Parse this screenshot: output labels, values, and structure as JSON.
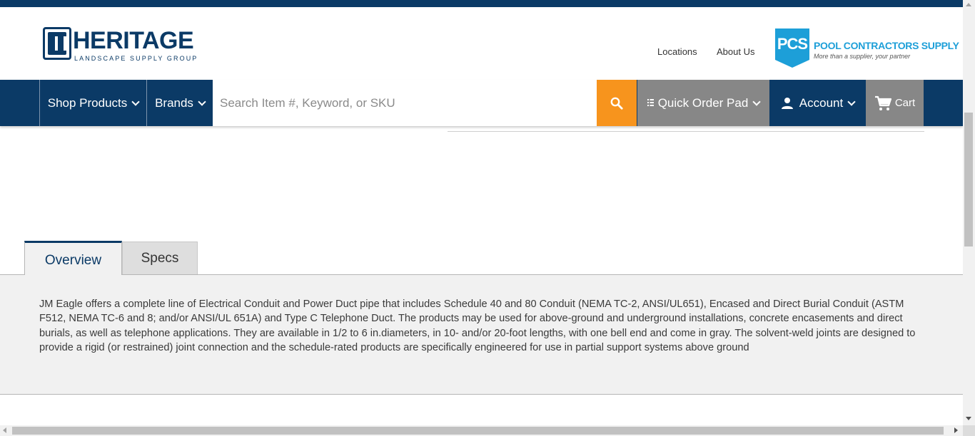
{
  "brand": {
    "name": "HERITAGE",
    "subtitle": "LANDSCAPE SUPPLY GROUP",
    "colors": {
      "navy": "#0b3a66",
      "orange": "#f7941d",
      "grey": "#878787",
      "pcs_blue": "#1d9fd8"
    }
  },
  "header": {
    "links": [
      {
        "label": "Locations"
      },
      {
        "label": "About Us"
      }
    ],
    "partner": {
      "badge": "PCS",
      "title": "POOL CONTRACTORS SUPPLY",
      "tagline": "More than a supplier, your partner"
    }
  },
  "nav": {
    "shop_products": "Shop Products",
    "brands": "Brands",
    "search_placeholder": "Search Item #, Keyword, or SKU",
    "search_icon": "search-icon",
    "quick_order": "Quick Order Pad",
    "account": "Account",
    "cart": "Cart"
  },
  "tabs": [
    {
      "label": "Overview",
      "active": true
    },
    {
      "label": "Specs",
      "active": false
    }
  ],
  "overview": {
    "text": "JM Eagle offers a complete line of Electrical Conduit and Power Duct pipe that includes Schedule 40 and 80 Conduit (NEMA TC-2, ANSI/UL651), Encased and Direct Burial Conduit (ASTM F512, NEMA TC-6 and 8; and/or ANSI/UL 651A) and Type C Telephone Duct. The products may be used for above-ground and underground installations, concrete encasements and direct burials, as well as telephone applications. They are available in 1/2 to 6 in.diameters, in 10- and/or 20-foot lengths, with one bell end and come in gray. The solvent-weld joints are designed to provide a rigid (or restrained) joint connection and the schedule-rated products are specifically engineered for use in partial support systems above ground"
  }
}
